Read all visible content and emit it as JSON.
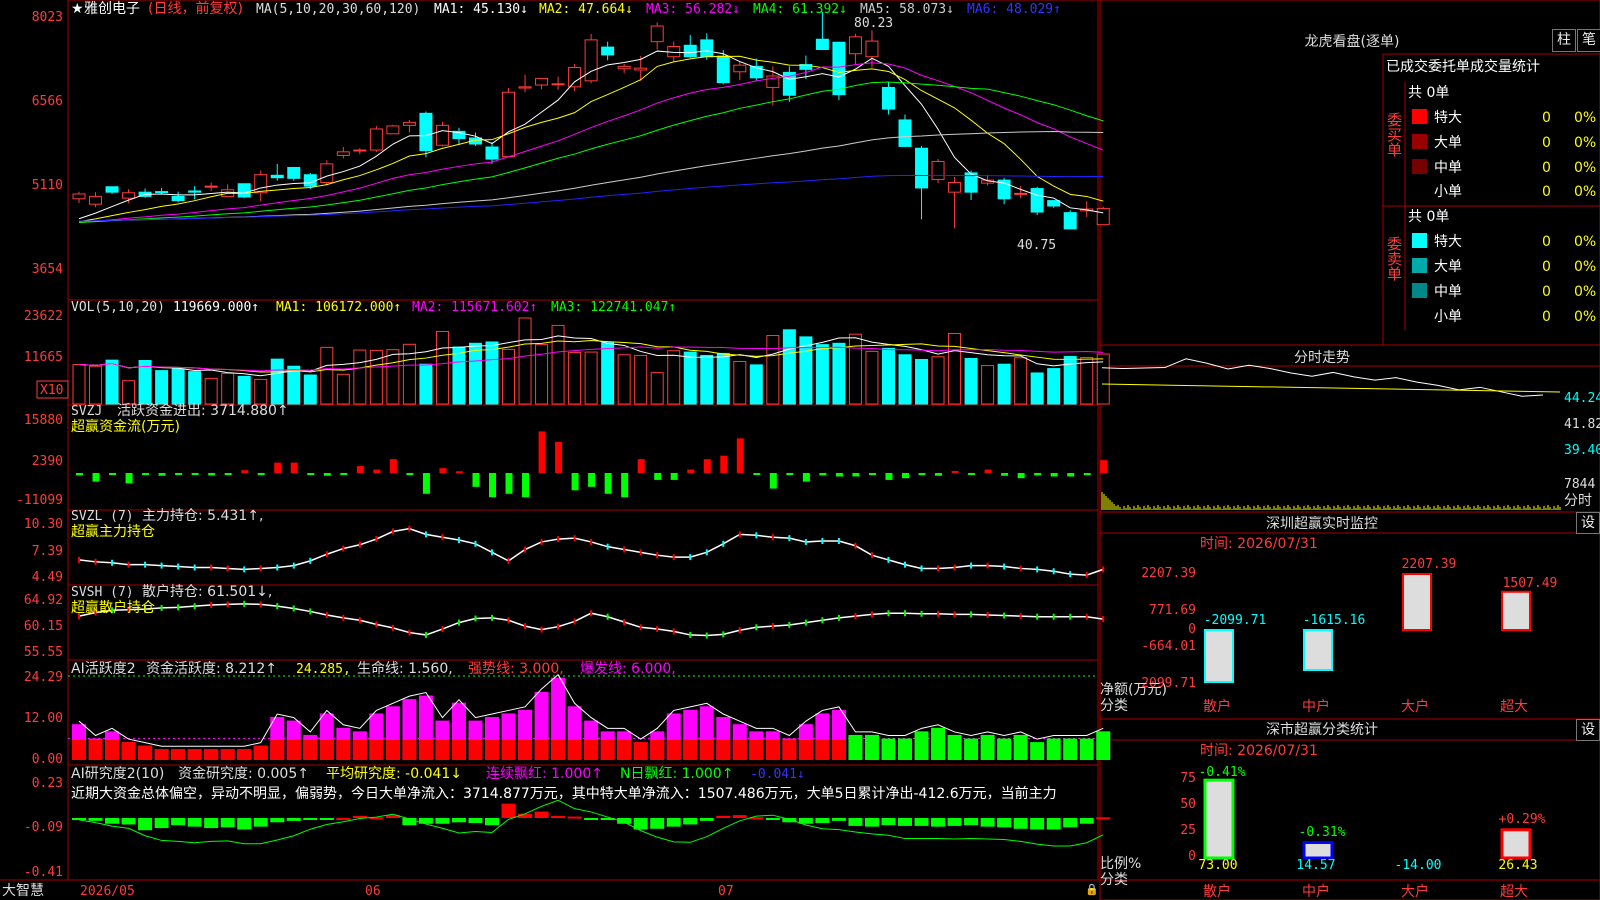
{
  "colors": {
    "up": "#ff3b3b",
    "down": "#00ffff",
    "grid": "#aa0000",
    "text": "#dddddd",
    "ma1": "#ffffff",
    "ma2": "#ffff00",
    "ma3": "#ff00ff",
    "ma4": "#00ff00",
    "ma5": "#cccccc",
    "ma6": "#2222ff",
    "money": "#ffff00",
    "magenta": "#ff00ff",
    "green": "#00ff00",
    "red": "#ff0000",
    "aqua": "#00ffff",
    "blue": "#0000ff"
  },
  "header": {
    "star": "★",
    "stock": "雅创电子",
    "mode": "(日线，前复权)",
    "ma_params": "MA(5,10,20,30,60,120)",
    "ma": [
      {
        "label": "MA1: 45.130↓",
        "color": "#ffffff"
      },
      {
        "label": "MA2: 47.664↓",
        "color": "#ffff00"
      },
      {
        "label": "MA3: 56.282↓",
        "color": "#ff00ff"
      },
      {
        "label": "MA4: 61.392↓",
        "color": "#00ff00"
      },
      {
        "label": "MA5: 58.073↓",
        "color": "#cccccc"
      },
      {
        "label": "MA6: 48.029↑",
        "color": "#3333ff"
      }
    ]
  },
  "price_axis": [
    "8023",
    "6566",
    "5110",
    "3654"
  ],
  "price_labels": {
    "high": "80.23",
    "low": "40.75"
  },
  "vol": {
    "title": "VOL(5,10,20)",
    "value": "119669.000↑",
    "ma1": "MA1: 106172.000↑",
    "ma2": "MA2: 115671.602↑",
    "ma3": "MA3: 122741.047↑",
    "axis": [
      "23622",
      "11665"
    ],
    "unit": "X10"
  },
  "svzj": {
    "title": "SVZJ",
    "desc": "活跃资金进出: 3714.880↑",
    "sub": "超赢资金流(万元)",
    "axis": [
      "15880",
      "2390",
      "-11099"
    ]
  },
  "svzl": {
    "title": "SVZL (7)",
    "desc": "主力持仓: 5.431↑,",
    "sub": "超赢主力持仓",
    "axis": [
      "10.30",
      "7.39",
      "4.49"
    ]
  },
  "svsh": {
    "title": "SVSH (7)",
    "desc": "散户持仓: 61.501↓,",
    "sub": "超赢散户持仓",
    "axis": [
      "64.92",
      "60.15",
      "55.55"
    ]
  },
  "ai1": {
    "title": "AI活跃度2",
    "desc": "资金活跃度: 8.212↑",
    "v2": "24.285,",
    "life": "生命线: 1.560,",
    "strong": "强势线: 3.000,",
    "burst": "爆发线: 6.000,",
    "axis": [
      "24.29",
      "12.00",
      "0.00"
    ]
  },
  "ai2": {
    "title": "AI研究度2(10)",
    "desc": "资金研究度: 0.005↑",
    "avg": "平均研究度: -0.041↓",
    "lian": "连续飘红: 1.000↑",
    "nri": "N日飘红: 1.000↑",
    "neg": "-0.041↓",
    "note": "近期大资金总体偏空，异动不明显，偏弱势，今日大单净流入：3714.877万元，其中特大单净流入：1507.486万元，大单5日累计净出-412.6万元，当前主力",
    "axis": [
      "0.23",
      "-0.09",
      "-0.41"
    ]
  },
  "date_axis": [
    "2026/05",
    "06",
    "07"
  ],
  "brand": "大智慧",
  "right": {
    "lhb_title": "龙虎看盘(逐单)",
    "btn1": "柱",
    "btn2": "笔",
    "table_title": "已成交委托单成交量统计",
    "buy_label": "委买单",
    "sell_label": "委卖单",
    "buy_total": "共 0单",
    "sell_total": "共 0单",
    "buy_rows": [
      {
        "name": "特大",
        "v": "0",
        "p": "0%",
        "color": "#ff0000"
      },
      {
        "name": "大单",
        "v": "0",
        "p": "0%",
        "color": "#990000"
      },
      {
        "name": "中单",
        "v": "0",
        "p": "0%",
        "color": "#770000"
      },
      {
        "name": "小单",
        "v": "0",
        "p": "0%",
        "color": ""
      }
    ],
    "sell_rows": [
      {
        "name": "特大",
        "v": "0",
        "p": "0%",
        "color": "#00ffff"
      },
      {
        "name": "大单",
        "v": "0",
        "p": "0%",
        "color": "#00aaaa"
      },
      {
        "name": "中单",
        "v": "0",
        "p": "0%",
        "color": "#008888"
      },
      {
        "name": "小单",
        "v": "0",
        "p": "0%",
        "color": ""
      }
    ],
    "fs_title": "分时走势",
    "fs_axis": [
      "44.24",
      "41.82",
      "39.40"
    ],
    "fs_vol": "7844",
    "fs_unit": "分时",
    "sz_title": "深圳超赢实时监控",
    "sz_time": "时间: 2026/07/31",
    "sz_btn": "设",
    "sz_axis": [
      "2207.39",
      "771.69",
      "0",
      "-664.01",
      "-2099.71"
    ],
    "sz_ylabel": "净额(万元)",
    "sz_xlabel": "分类",
    "sz_cats": [
      "散户",
      "中户",
      "大户",
      "超大"
    ],
    "sz_values": [
      "-2099.71",
      "-1615.16",
      "2207.39",
      "1507.49"
    ],
    "ss_title": "深市超赢分类统计",
    "ss_time": "时间: 2026/07/31",
    "ss_btn": "设",
    "ss_axis": [
      "75",
      "50",
      "25",
      "0"
    ],
    "ss_ylabel": "比例%",
    "ss_xlabel": "分类",
    "ss_cats": [
      "散户",
      "中户",
      "大户",
      "超大"
    ],
    "ss_top": [
      "-0.41%",
      "-0.31%",
      "",
      "+0.29%"
    ],
    "ss_bottom": [
      "73.00",
      "14.57",
      "-14.00",
      "26.43"
    ]
  },
  "chart_data": [
    {
      "type": "candlestick",
      "series": [
        {
          "name": "雅创电子"
        }
      ],
      "o": [
        49.2,
        48.3,
        51.2,
        49.3,
        50.3,
        50.4,
        49.6,
        50.5,
        51.3,
        49.6,
        51.7,
        50.2,
        53.1,
        54.4,
        53.2,
        51.9,
        56.4,
        57.2,
        57.3,
        60.0,
        61.4,
        63.4,
        58.1,
        60.4,
        59.3,
        57.8,
        56.2,
        67.6,
        68.1,
        68.3,
        67.8,
        68.8,
        74.4,
        70.8,
        70.6,
        75.3,
        72.8,
        74.7,
        75.6,
        72.9,
        70.3,
        71.2,
        67.7,
        70.2,
        71.5,
        75.7,
        75.2,
        73.3,
        72.8,
        67.7,
        62.3,
        57.6,
        52.4,
        50.3,
        53.5,
        51.8,
        52.3,
        50.1,
        50.9,
        48.9,
        46.9,
        47.2,
        44.9
      ],
      "c": [
        50.0,
        49.6,
        50.3,
        50.2,
        49.6,
        50.3,
        48.9,
        50.3,
        51.3,
        50.7,
        49.5,
        53.2,
        52.7,
        52.6,
        51.3,
        55.0,
        57.0,
        57.3,
        60.8,
        61.3,
        61.9,
        57.2,
        61.4,
        59.2,
        58.3,
        55.8,
        66.9,
        67.8,
        69.2,
        68.3,
        71.0,
        75.6,
        73.1,
        71.2,
        70.9,
        77.9,
        74.5,
        72.8,
        72.8,
        68.5,
        71.4,
        69.3,
        69.6,
        66.4,
        70.7,
        74.0,
        66.5,
        76.1,
        75.4,
        64.1,
        57.9,
        51.0,
        55.4,
        51.9,
        50.3,
        52.3,
        49.2,
        50.1,
        47.0,
        48.0,
        44.2,
        47.5,
        47.6
      ],
      "h": [
        50.4,
        50.3,
        50.8,
        50.8,
        50.9,
        51.0,
        50.4,
        51.3,
        51.9,
        51.6,
        51.7,
        53.9,
        55.0,
        54.5,
        53.5,
        55.6,
        57.8,
        57.6,
        61.3,
        61.5,
        62.3,
        63.7,
        62.0,
        61.0,
        60.2,
        58.6,
        67.6,
        69.8,
        69.2,
        69.5,
        71.6,
        76.6,
        75.3,
        71.6,
        72.9,
        78.5,
        75.3,
        76.4,
        76.7,
        73.9,
        72.0,
        72.5,
        71.2,
        71.2,
        73.0,
        80.23,
        75.3,
        76.6,
        77.2,
        68.6,
        63.2,
        58.0,
        55.8,
        52.8,
        53.9,
        53.2,
        52.7,
        51.3,
        51.2,
        49.0,
        47.3,
        48.8,
        47.9
      ],
      "l": [
        48.5,
        47.8,
        50.0,
        48.5,
        49.4,
        50.0,
        48.6,
        49.1,
        50.5,
        49.6,
        49.3,
        48.8,
        52.2,
        52.2,
        50.8,
        51.4,
        55.9,
        56.6,
        57.0,
        60.0,
        60.2,
        56.1,
        57.9,
        58.2,
        58.0,
        55.0,
        56.2,
        66.9,
        67.4,
        67.3,
        67.1,
        68.4,
        72.2,
        70.1,
        68.8,
        74.0,
        71.9,
        72.6,
        72.3,
        68.2,
        68.9,
        68.8,
        64.7,
        65.3,
        69.1,
        73.9,
        65.6,
        71.6,
        71.0,
        63.2,
        57.8,
        45.8,
        51.8,
        44.3,
        49.0,
        51.4,
        48.3,
        49.3,
        46.5,
        47.7,
        44.1,
        46.2,
        44.9
      ]
    },
    {
      "type": "bar",
      "name": "VOL",
      "values": [
        117,
        112,
        130,
        69,
        129,
        99,
        104,
        96,
        76,
        91,
        82,
        73,
        133,
        112,
        86,
        168,
        88,
        160,
        159,
        161,
        177,
        118,
        215,
        169,
        180,
        184,
        162,
        255,
        176,
        233,
        153,
        154,
        182,
        146,
        144,
        93,
        158,
        154,
        144,
        150,
        126,
        116,
        203,
        220,
        199,
        176,
        180,
        207,
        156,
        165,
        146,
        132,
        140,
        209,
        135,
        114,
        118,
        137,
        92,
        105,
        141,
        138,
        148
      ]
    },
    {
      "type": "bar",
      "name": "SVZJ",
      "values": [
        -700,
        -2500,
        -500,
        -3000,
        -600,
        -800,
        -500,
        -500,
        -700,
        -600,
        800,
        -600,
        3000,
        3000,
        -600,
        -800,
        -500,
        2000,
        1000,
        4000,
        -600,
        -6000,
        1400,
        500,
        -4000,
        -7000,
        -6000,
        -7000,
        12000,
        9000,
        -5000,
        -4000,
        -6000,
        -7000,
        4000,
        -2000,
        -2000,
        1000,
        4000,
        5000,
        10000,
        -200,
        -4500,
        -600,
        -2500,
        -700,
        -1000,
        -1000,
        -600,
        -2000,
        -1500,
        -600,
        -800,
        600,
        -500,
        1000,
        -800,
        -1500,
        -700,
        -1000,
        -1000,
        -600,
        3714.88
      ]
    },
    {
      "type": "line",
      "name": "SVZL",
      "values": [
        6.4,
        6.2,
        6.1,
        5.9,
        5.9,
        5.8,
        5.7,
        5.6,
        5.6,
        5.5,
        5.4,
        5.5,
        5.6,
        5.8,
        6.3,
        7.0,
        7.6,
        8.0,
        8.6,
        9.4,
        9.7,
        9.1,
        8.8,
        8.5,
        8.1,
        7.2,
        6.3,
        7.5,
        8.3,
        8.6,
        8.7,
        8.3,
        7.8,
        7.5,
        7.2,
        6.9,
        6.7,
        6.7,
        7.2,
        8.1,
        9.1,
        9.0,
        8.8,
        8.7,
        8.3,
        8.4,
        8.4,
        7.9,
        6.9,
        6.4,
        5.9,
        5.5,
        5.5,
        5.6,
        5.8,
        5.8,
        5.7,
        5.5,
        5.4,
        5.2,
        4.9,
        4.8,
        5.4
      ]
    },
    {
      "type": "line",
      "name": "SVSH",
      "values": [
        62.0,
        62.6,
        63.0,
        63.1,
        63.2,
        63.4,
        63.5,
        63.7,
        63.9,
        64.0,
        64.1,
        64.0,
        63.7,
        63.3,
        62.8,
        62.2,
        61.7,
        61.3,
        60.6,
        60.0,
        59.2,
        58.8,
        59.8,
        60.9,
        61.6,
        61.7,
        61.3,
        60.3,
        59.7,
        60.2,
        61.1,
        62.5,
        61.9,
        61.0,
        60.1,
        59.8,
        59.4,
        58.8,
        58.7,
        58.9,
        59.6,
        60.1,
        60.3,
        60.5,
        60.9,
        61.3,
        61.7,
        62.0,
        62.3,
        62.5,
        62.5,
        62.4,
        62.4,
        62.3,
        62.3,
        62.2,
        62.1,
        62.0,
        61.9,
        61.9,
        61.9,
        61.9,
        61.5
      ]
    },
    {
      "type": "bar",
      "name": "AI活跃度2",
      "values": [
        10,
        6,
        8,
        5,
        4,
        3,
        3,
        3,
        3,
        3,
        3,
        4,
        12,
        11,
        7,
        13,
        9,
        8,
        13,
        15,
        17,
        18,
        11,
        16,
        11,
        12,
        13,
        14,
        19,
        23,
        15,
        11,
        8,
        8,
        5,
        8,
        13,
        14,
        15,
        12,
        10,
        8,
        8,
        6,
        10,
        13,
        14,
        7,
        7,
        6,
        6,
        8,
        9,
        7,
        6,
        7,
        6,
        7,
        5,
        6,
        6,
        6,
        8
      ]
    },
    {
      "type": "bar",
      "name": "AI研究度2",
      "values": [
        -0.005,
        -0.02,
        -0.04,
        -0.045,
        -0.085,
        -0.07,
        -0.05,
        -0.06,
        -0.07,
        -0.065,
        -0.08,
        -0.06,
        -0.03,
        -0.02,
        -0.01,
        -0.01,
        0.0,
        0.015,
        0.005,
        0.02,
        -0.05,
        -0.04,
        -0.04,
        -0.03,
        -0.035,
        -0.05,
        0.1,
        0.03,
        0.045,
        0.015,
        0.01,
        -0.005,
        -0.01,
        -0.04,
        -0.08,
        -0.075,
        -0.06,
        -0.045,
        -0.02,
        0.015,
        0.02,
        0.005,
        -0.01,
        -0.03,
        -0.04,
        -0.035,
        -0.02,
        -0.055,
        -0.06,
        -0.05,
        -0.055,
        -0.055,
        -0.06,
        -0.055,
        -0.05,
        -0.06,
        -0.065,
        -0.075,
        -0.08,
        -0.08,
        -0.065,
        -0.04,
        0.005
      ]
    },
    {
      "type": "line",
      "name": "分时走势",
      "values": [
        44.0,
        44.1,
        44.3,
        44.5,
        44.8,
        44.6,
        44.3,
        44.2,
        44.1,
        43.9,
        43.8,
        43.7,
        43.5,
        43.4,
        43.2,
        43.0,
        42.9,
        42.7,
        42.5,
        42.3,
        42.1,
        41.8
      ]
    },
    {
      "type": "bar",
      "name": "深圳超赢实时监控",
      "categories": [
        "散户",
        "中户",
        "大户",
        "超大"
      ],
      "values": [
        -2099.71,
        -1615.16,
        2207.39,
        1507.49
      ],
      "ylim": [
        -2099.71,
        2207.39
      ]
    },
    {
      "type": "bar",
      "name": "深市超赢分类统计",
      "categories": [
        "散户",
        "中户",
        "大户",
        "超大"
      ],
      "values": [
        73.0,
        14.57,
        -14.0,
        26.43
      ],
      "ylim": [
        0,
        75
      ]
    }
  ]
}
